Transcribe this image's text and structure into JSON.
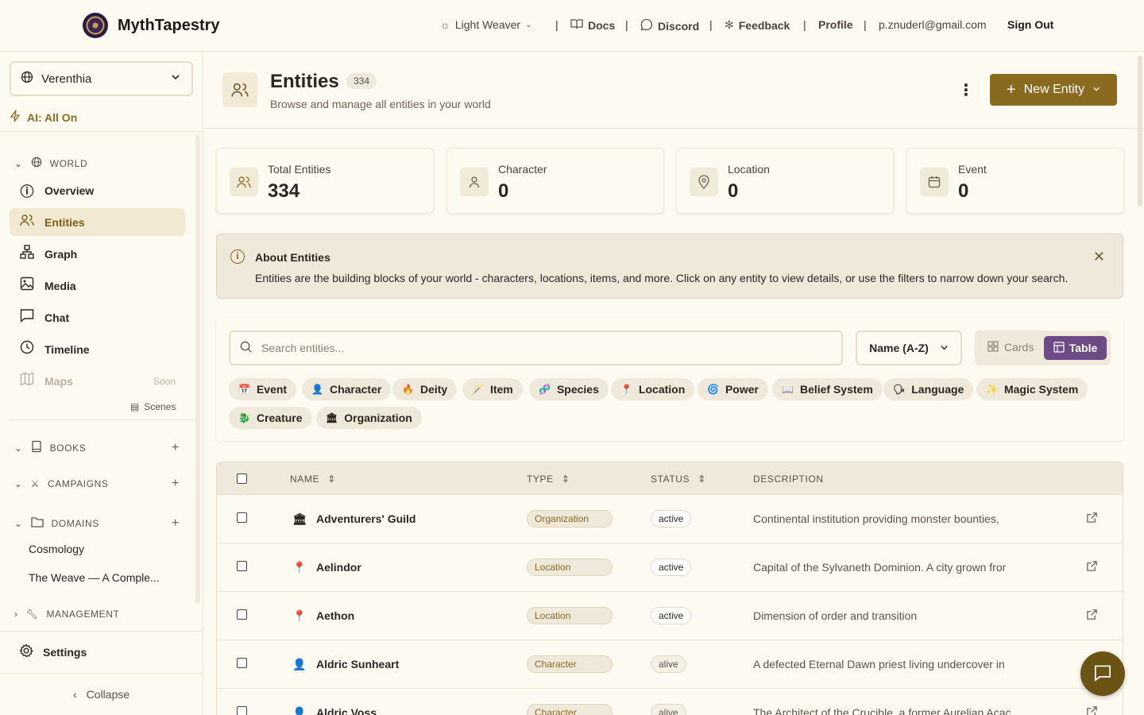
{
  "app": {
    "brand": "MythTapestry"
  },
  "topnav": {
    "theme": "Light Weaver",
    "docs": "Docs",
    "discord": "Discord",
    "feedback": "Feedback",
    "profile": "Profile",
    "email": "p.znuderl@gmail.com",
    "signout": "Sign Out"
  },
  "sidebar": {
    "world": "Verenthia",
    "ai": "AI: All On",
    "sections": {
      "world": "WORLD",
      "books": "BOOKS",
      "campaigns": "CAMPAIGNS",
      "domains": "DOMAINS",
      "management": "MANAGEMENT"
    },
    "items": [
      {
        "label": "Overview"
      },
      {
        "label": "Entities"
      },
      {
        "label": "Graph"
      },
      {
        "label": "Media"
      },
      {
        "label": "Chat"
      },
      {
        "label": "Timeline"
      },
      {
        "label": "Maps",
        "badge": "Soon"
      }
    ],
    "scenes": "Scenes",
    "domains": [
      "Cosmology",
      "The Weave — A Comple..."
    ],
    "settings": "Settings",
    "collapse": "Collapse"
  },
  "header": {
    "title": "Entities",
    "count": "334",
    "subtitle": "Browse and manage all entities in your world",
    "new_button": "New Entity"
  },
  "stats": [
    {
      "label": "Total Entities",
      "value": "334"
    },
    {
      "label": "Character",
      "value": "0"
    },
    {
      "label": "Location",
      "value": "0"
    },
    {
      "label": "Event",
      "value": "0"
    }
  ],
  "info": {
    "title": "About Entities",
    "text": "Entities are the building blocks of your world - characters, locations, items, and more. Click on any entity to view details, or use the filters to narrow down your search."
  },
  "filters": {
    "search_placeholder": "Search entities...",
    "sort": "Name (A-Z)",
    "view_cards": "Cards",
    "view_table": "Table",
    "chips": [
      "Event",
      "Character",
      "Deity",
      "Item",
      "Species",
      "Location",
      "Power",
      "Belief System",
      "Language",
      "Magic System",
      "Creature",
      "Organization"
    ]
  },
  "table": {
    "headers": {
      "name": "NAME",
      "type": "TYPE",
      "status": "STATUS",
      "description": "DESCRIPTION"
    },
    "rows": [
      {
        "name": "Adventurers' Guild",
        "type": "Organization",
        "status": "active",
        "description": "Continental institution providing monster bounties,"
      },
      {
        "name": "Aelindor",
        "type": "Location",
        "status": "active",
        "description": "Capital of the Sylvaneth Dominion. A city grown fror"
      },
      {
        "name": "Aethon",
        "type": "Location",
        "status": "active",
        "description": "Dimension of order and transition"
      },
      {
        "name": "Aldric Sunheart",
        "type": "Character",
        "status": "alive",
        "description": "A defected Eternal Dawn priest living undercover in"
      },
      {
        "name": "Aldric Voss",
        "type": "Character",
        "status": "alive",
        "description": "The Architect of the Crucible, a former Aurelian Acac"
      }
    ]
  }
}
